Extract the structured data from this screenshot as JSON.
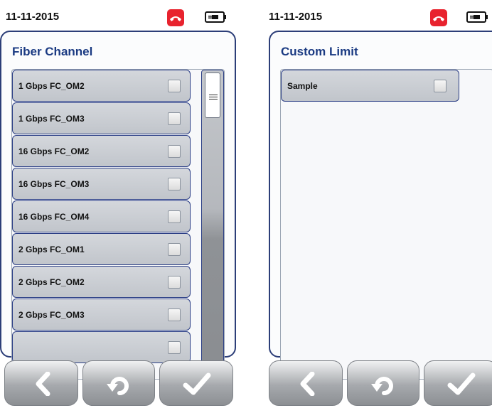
{
  "screens": [
    {
      "date": "11-11-2015",
      "title": "Fiber Channel",
      "items": [
        {
          "label": "1 Gbps FC_OM2",
          "checked": false
        },
        {
          "label": "1 Gbps FC_OM3",
          "checked": false
        },
        {
          "label": "16 Gbps FC_OM2",
          "checked": false
        },
        {
          "label": "16 Gbps FC_OM3",
          "checked": false
        },
        {
          "label": "16 Gbps FC_OM4",
          "checked": false
        },
        {
          "label": "2 Gbps FC_OM1",
          "checked": false
        },
        {
          "label": "2 Gbps FC_OM2",
          "checked": false
        },
        {
          "label": "2 Gbps FC_OM3",
          "checked": false
        }
      ],
      "icons": {
        "call": "phone-hangup-icon",
        "power": "battery-plug-icon"
      },
      "nav": [
        "back-chevron-icon",
        "undo-icon",
        "confirm-check-icon"
      ],
      "accent_color": "#2c3e78",
      "call_color": "#e8232e"
    },
    {
      "date": "11-11-2015",
      "title": "Custom Limit",
      "items": [
        {
          "label": "Sample",
          "checked": false
        }
      ],
      "icons": {
        "call": "phone-hangup-icon",
        "power": "battery-plug-icon"
      },
      "nav": [
        "back-chevron-icon",
        "undo-icon",
        "confirm-check-icon"
      ],
      "accent_color": "#2c3e78",
      "call_color": "#e8232e"
    }
  ]
}
